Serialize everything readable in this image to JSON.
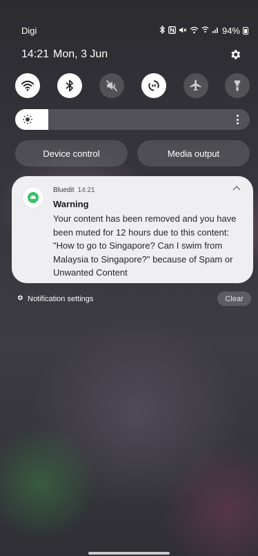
{
  "status_bar": {
    "carrier": "Digi",
    "battery_percent": "94%",
    "icons": [
      "bluetooth-icon",
      "nfc-icon",
      "mute-icon",
      "wifi-icon",
      "hotspot-icon",
      "signal-icon",
      "battery-icon"
    ]
  },
  "header": {
    "time": "14:21",
    "date": "Mon, 3 Jun"
  },
  "quick_settings": {
    "toggles": [
      {
        "name": "wifi",
        "icon": "wifi-icon",
        "state": "on"
      },
      {
        "name": "bluetooth",
        "icon": "bluetooth-icon",
        "state": "on"
      },
      {
        "name": "sound",
        "icon": "mute-icon",
        "state": "off"
      },
      {
        "name": "auto-rotate",
        "icon": "rotate-icon",
        "state": "on"
      },
      {
        "name": "airplane-mode",
        "icon": "airplane-icon",
        "state": "off"
      },
      {
        "name": "flashlight",
        "icon": "flashlight-icon",
        "state": "off"
      }
    ],
    "brightness_level": 0.14,
    "device_control_label": "Device control",
    "media_output_label": "Media output"
  },
  "notification": {
    "app_name": "Bluedit",
    "time": "14:21",
    "title": "Warning",
    "body": "Your content has been removed and you have been muted for 12 hours due to this content: \"How to go to Singapore? Can I swim from Malaysia to Singapore?\" because of Spam or Unwanted Content",
    "icon_color": "#36c26a"
  },
  "footer": {
    "settings_label": "Notification settings",
    "clear_label": "Clear"
  }
}
